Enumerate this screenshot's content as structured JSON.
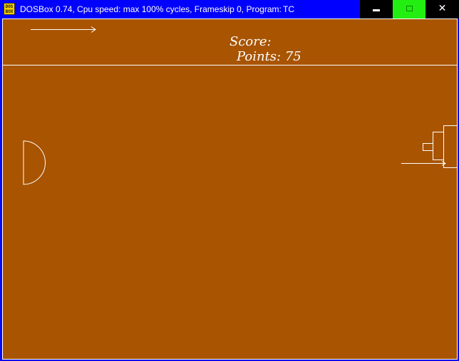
{
  "titlebar": {
    "app_icon_text": "DOS BOX",
    "title": "DOSBox 0.74, Cpu speed: max 100% cycles, Frameskip  0, Program:",
    "program": "TC",
    "minimize_icon": "minimize-icon",
    "maximize_icon": "maximize-icon",
    "close_icon": "close-icon",
    "close_glyph": "✕"
  },
  "game": {
    "score_label": "Score:",
    "points_text": "Points: 75"
  },
  "colors": {
    "titlebar": "#0000ff",
    "playfield": "#a85400",
    "lines": "#ffffff",
    "maximize_button": "#22ee11"
  }
}
